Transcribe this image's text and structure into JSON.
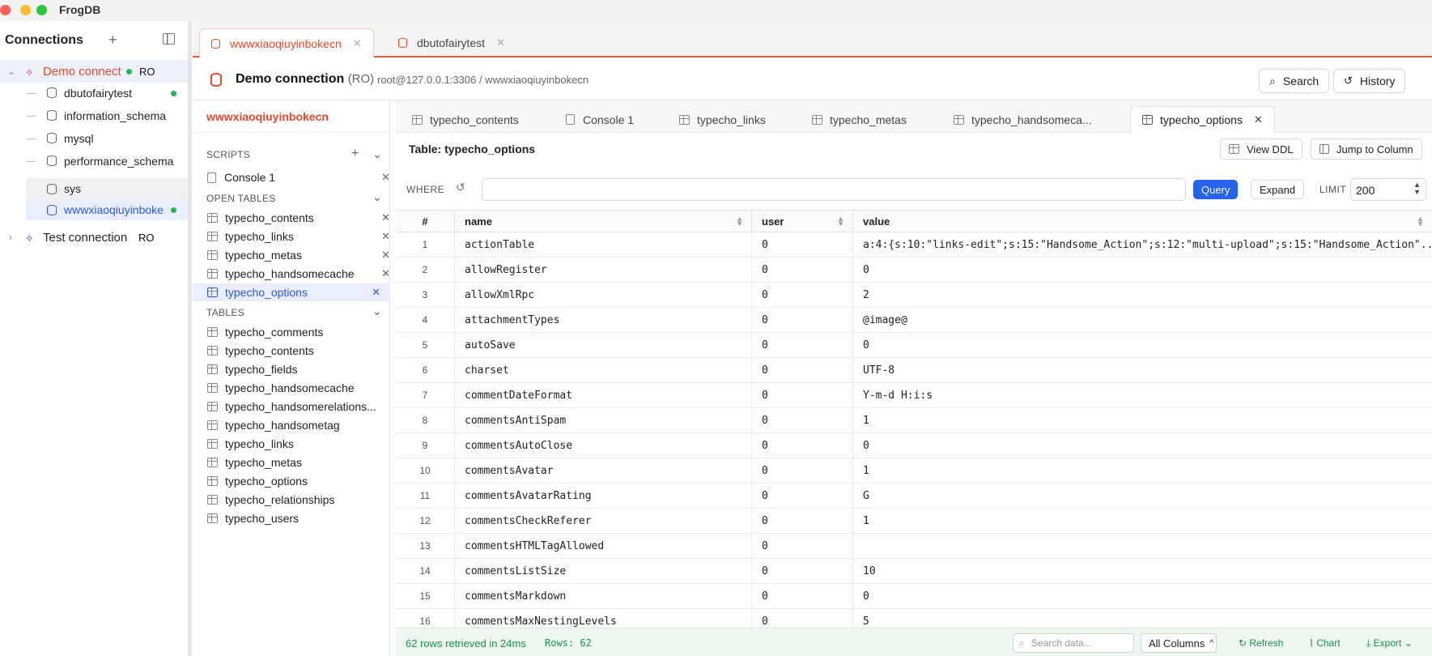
{
  "app": {
    "title": "FrogDB",
    "accent": "#e34b2e"
  },
  "connections": {
    "title": "Connections",
    "demo": {
      "name": "Demo connect",
      "badge": "RO"
    },
    "databases": [
      "dbutofairytest",
      "information_schema",
      "mysql",
      "performance_schema",
      "sys",
      "wwwxiaoqiuyinboke"
    ],
    "test": {
      "name": "Test connection",
      "badge": "RO"
    }
  },
  "top_tabs": [
    {
      "label": "wwwxiaoqiuyinbokecn"
    },
    {
      "label": "dbutofairytest"
    }
  ],
  "conn_header": {
    "name": "Demo connection",
    "ro": "(RO)",
    "path": "root@127.0.0.1:3306 / wwwxiaoqiuyinbokecn",
    "search": "Search",
    "history": "History"
  },
  "db_panel": {
    "title": "wwwxiaoqiuyinbokecn",
    "scripts_label": "SCRIPTS",
    "scripts": [
      "Console 1"
    ],
    "open_tables_label": "OPEN TABLES",
    "open_tables": [
      "typecho_contents",
      "typecho_links",
      "typecho_metas",
      "typecho_handsomecache",
      "typecho_options"
    ],
    "tables_label": "TABLES",
    "tables": [
      "typecho_comments",
      "typecho_contents",
      "typecho_fields",
      "typecho_handsomecache",
      "typecho_handsomerelations...",
      "typecho_handsometag",
      "typecho_links",
      "typecho_metas",
      "typecho_options",
      "typecho_relationships",
      "typecho_users"
    ]
  },
  "sub_tabs": [
    "typecho_contents",
    "Console 1",
    "typecho_links",
    "typecho_metas",
    "typecho_handsomeca...",
    "typecho_options"
  ],
  "table_bar": {
    "title": "Table: typecho_options",
    "view_ddl": "View DDL",
    "jump": "Jump to Column"
  },
  "where": {
    "label": "WHERE",
    "value": "",
    "query": "Query",
    "expand": "Expand",
    "limit_label": "LIMIT",
    "limit": "200"
  },
  "grid": {
    "headers": [
      "#",
      "name",
      "user",
      "value"
    ],
    "rows": [
      [
        "1",
        "actionTable",
        "0",
        "a:4:{s:10:\"links-edit\";s:15:\"Handsome_Action\";s:12:\"multi-upload\";s:15:\"Handsome_Action\"..."
      ],
      [
        "2",
        "allowRegister",
        "0",
        "0"
      ],
      [
        "3",
        "allowXmlRpc",
        "0",
        "2"
      ],
      [
        "4",
        "attachmentTypes",
        "0",
        "@image@"
      ],
      [
        "5",
        "autoSave",
        "0",
        "0"
      ],
      [
        "6",
        "charset",
        "0",
        "UTF-8"
      ],
      [
        "7",
        "commentDateFormat",
        "0",
        "Y-m-d H:i:s"
      ],
      [
        "8",
        "commentsAntiSpam",
        "0",
        "1"
      ],
      [
        "9",
        "commentsAutoClose",
        "0",
        "0"
      ],
      [
        "10",
        "commentsAvatar",
        "0",
        "1"
      ],
      [
        "11",
        "commentsAvatarRating",
        "0",
        "G"
      ],
      [
        "12",
        "commentsCheckReferer",
        "0",
        "1"
      ],
      [
        "13",
        "commentsHTMLTagAllowed",
        "0",
        ""
      ],
      [
        "14",
        "commentsListSize",
        "0",
        "10"
      ],
      [
        "15",
        "commentsMarkdown",
        "0",
        "0"
      ],
      [
        "16",
        "commentsMaxNestingLevels",
        "0",
        "5"
      ]
    ]
  },
  "footer": {
    "status": "62 rows retrieved in 24ms",
    "rows": "Rows: 62",
    "search_placeholder": "Search data...",
    "columns": "All Columns",
    "refresh": "Refresh",
    "chart": "Chart",
    "export": "Export"
  }
}
